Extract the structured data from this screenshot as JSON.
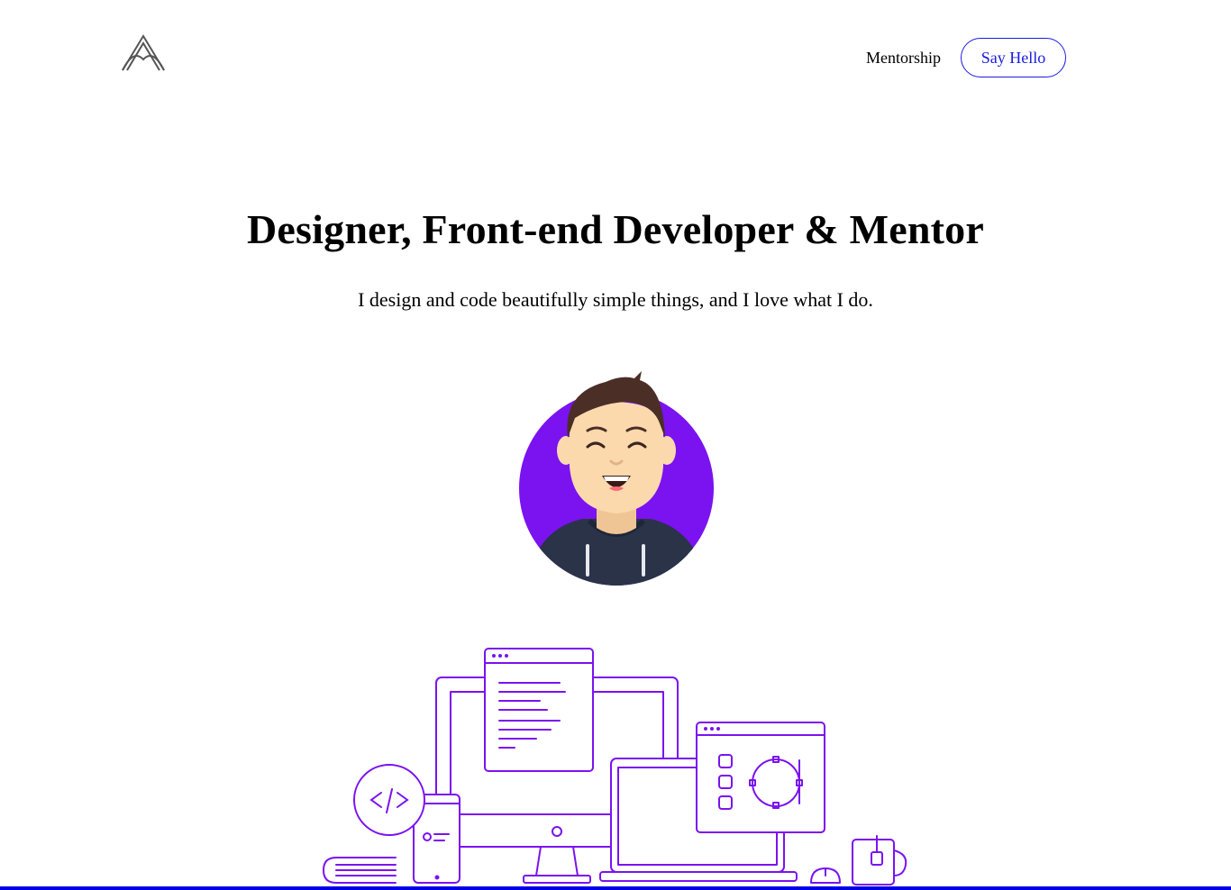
{
  "nav": {
    "mentorship_label": "Mentorship",
    "say_hello_label": "Say Hello"
  },
  "hero": {
    "title": "Designer, Front-end Developer & Mentor",
    "subtitle": "I design and code beautifully simple things, and I love what I do."
  },
  "colors": {
    "accent_purple": "#7b12f0",
    "link_blue": "#1a1ae0",
    "bottom_bar": "#0000e6",
    "hoodie": "#2a3348",
    "skin": "#fbd9ad",
    "hair": "#4b2e26"
  },
  "icons": [
    "logo-mark-icon",
    "code-brackets-icon"
  ]
}
